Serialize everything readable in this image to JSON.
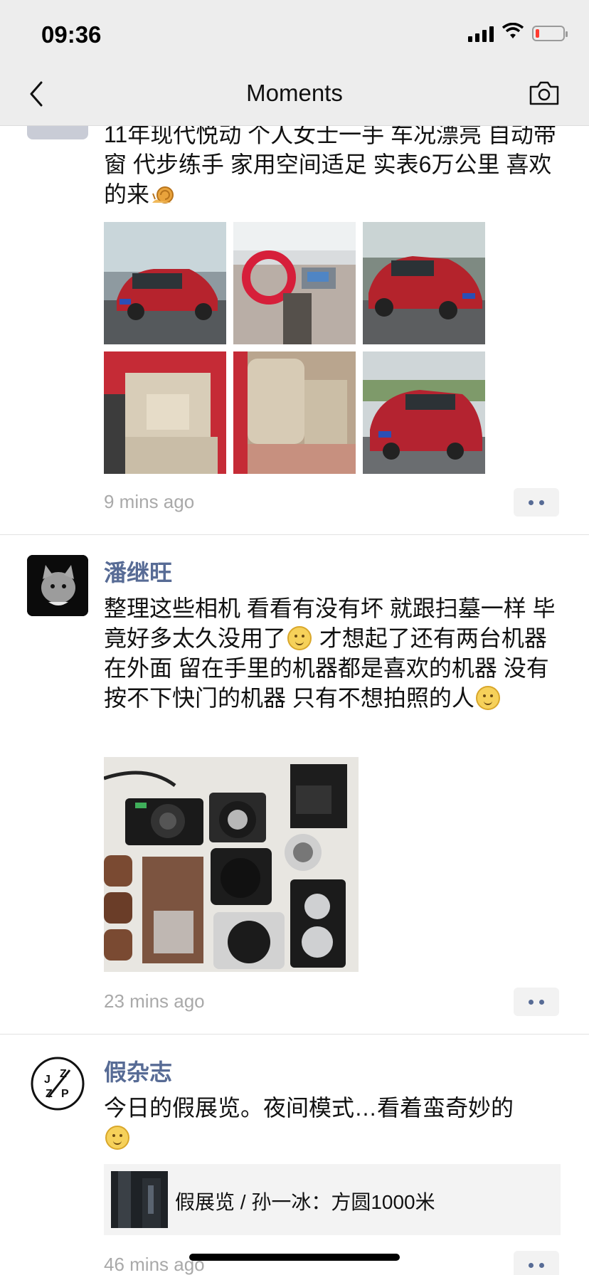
{
  "status_bar": {
    "time": "09:36",
    "battery_level": 0.15
  },
  "nav": {
    "title": "Moments",
    "back_icon": "chevron-left-icon",
    "camera_icon": "camera-icon"
  },
  "posts": [
    {
      "text": "11年现代悦动 个人女士一手 车况漂亮 自动带窗 代步练手 家用空间适足 实表6万公里  喜欢的来",
      "emoji": "snail",
      "time": "9 mins ago",
      "photo_count": 6
    },
    {
      "name": "潘继旺",
      "text_parts": [
        "整理这些相机 看看有没有坏 就跟扫墓一样 毕竟好多太久没用了",
        " 才想起了还有两台机器在外面 留在手里的机器都是喜欢的机器 没有按不下快门的机器 只有不想拍照的人",
        ""
      ],
      "time": "23 mins ago"
    },
    {
      "name": "假杂志",
      "avatar_letters": [
        "J",
        "Z",
        "Z",
        "P"
      ],
      "text": "今日的假展览。夜间模式…看着蛮奇妙的",
      "link_title": "假展览 / 孙一冰：方圆1000米",
      "time": "46 mins ago"
    }
  ],
  "colors": {
    "name": "#576b95",
    "time": "#a9a9a9",
    "nav_bg": "#ededed"
  }
}
